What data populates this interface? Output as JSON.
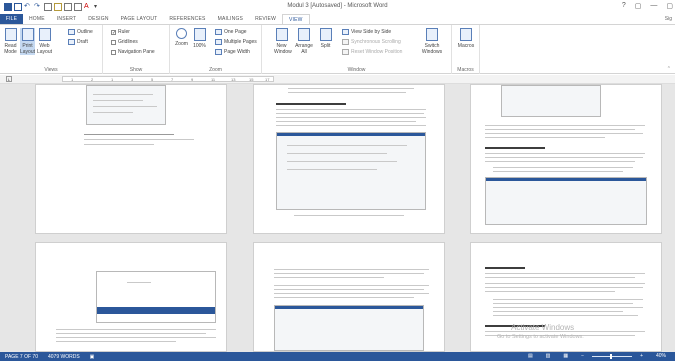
{
  "window": {
    "title": "Modul 3 [Autosaved] - Microsoft Word",
    "controls": [
      "?",
      "▢",
      "—",
      "▢"
    ],
    "user": "Sig"
  },
  "tabs": [
    "FILE",
    "HOME",
    "INSERT",
    "DESIGN",
    "PAGE LAYOUT",
    "REFERENCES",
    "MAILINGS",
    "REVIEW",
    "VIEW"
  ],
  "ribbon": {
    "views": {
      "label": "Views",
      "read_mode": "Read Mode",
      "print_layout": "Print Layout",
      "web_layout": "Web Layout",
      "outline": "Outline",
      "draft": "Draft"
    },
    "show": {
      "label": "Show",
      "ruler": "Ruler",
      "gridlines": "Gridlines",
      "navigation_pane": "Navigation Pane"
    },
    "zoom": {
      "label": "Zoom",
      "zoom": "Zoom",
      "hundred": "100%",
      "one_page": "One Page",
      "multiple_pages": "Multiple Pages",
      "page_width": "Page Width"
    },
    "window": {
      "label": "Window",
      "new_window": "New Window",
      "arrange_all": "Arrange All",
      "split": "Split",
      "view_side_by_side": "View Side by Side",
      "sync_scrolling": "Synchronous Scrolling",
      "reset_position": "Reset Window Position",
      "switch_windows": "Switch Windows"
    },
    "macros": {
      "label": "Macros",
      "macros": "Macros"
    }
  },
  "ruler": {
    "marker": "L",
    "numbers": [
      "1",
      "2",
      "1",
      "3",
      "5",
      "7",
      "9",
      "11",
      "13",
      "15",
      "17"
    ]
  },
  "status": {
    "page": "PAGE 7 OF 70",
    "words": "4079 WORDS",
    "zoom": "40%"
  },
  "watermark": {
    "title": "Activate Windows",
    "subtitle": "Go to Settings to activate Windows."
  },
  "colors": {
    "accent": "#2b579a",
    "ribbon_bg": "#ffffff",
    "doc_bg": "#e6e6e6"
  }
}
